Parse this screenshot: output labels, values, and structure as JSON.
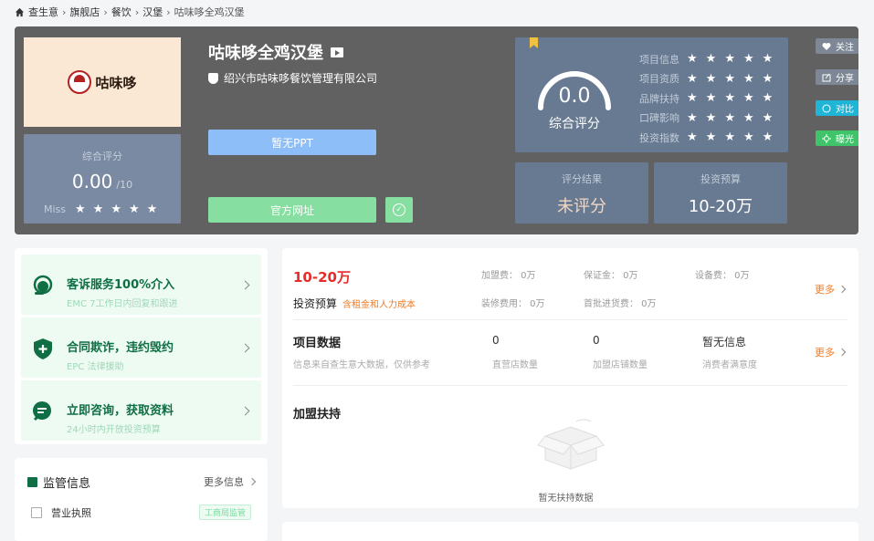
{
  "breadcrumb": {
    "items": [
      "查生意",
      "旗舰店",
      "餐饮",
      "汉堡"
    ],
    "current": "咕味哆全鸡汉堡"
  },
  "brand": {
    "name": "咕味哆全鸡汉堡",
    "company": "绍兴市咕味哆餐饮管理有限公司",
    "logo_text": "咕味哆"
  },
  "score_card": {
    "label": "综合评分",
    "value": "0.00",
    "max": "/10",
    "miss_label": "Miss",
    "stars": 5
  },
  "buttons": {
    "ppt": "暂无PPT",
    "website": "官方网址"
  },
  "rating": {
    "value": "0.0",
    "label": "综合评分",
    "rows": [
      {
        "label": "项目信息",
        "stars": 5
      },
      {
        "label": "项目资质",
        "stars": 5
      },
      {
        "label": "品牌扶持",
        "stars": 5
      },
      {
        "label": "口碑影响",
        "stars": 5
      },
      {
        "label": "投资指数",
        "stars": 5
      }
    ]
  },
  "stats": {
    "result_label": "评分结果",
    "result_value": "未评分",
    "budget_label": "投资预算",
    "budget_value": "10-20万"
  },
  "side_actions": {
    "follow": "关注",
    "share": "分享",
    "compare": "对比",
    "expose": "曝光"
  },
  "services": [
    {
      "title": "客诉服务100%介入",
      "sub": "EMC 7工作日内回复和跟进"
    },
    {
      "title": "合同欺诈，违约毁约",
      "sub": "EPC 法律援助"
    },
    {
      "title": "立即咨询，获取资料",
      "sub": "24小时内开放投资预算"
    }
  ],
  "regulation": {
    "title": "监管信息",
    "more": "更多信息",
    "item": "营业执照",
    "badge": "工商局监管"
  },
  "investment": {
    "amount": "10-20万",
    "label": "投资预算",
    "note": "含租金和人力成本",
    "fees": {
      "join": "加盟费： 0万",
      "deposit": "保证金： 0万",
      "equipment": "设备费： 0万",
      "decoration": "装修费用： 0万",
      "first_stock": "首批进货费： 0万"
    },
    "more": "更多"
  },
  "project_data": {
    "title": "项目数据",
    "desc": "信息来自查生意大数据，仅供参考",
    "direct_value": "0",
    "direct_label": "直营店数量",
    "franchise_value": "0",
    "franchise_label": "加盟店铺数量",
    "review_value": "暂无信息",
    "review_label": "消费者满意度",
    "more": "更多"
  },
  "support": {
    "title": "加盟扶持",
    "empty": "暂无扶持数据"
  },
  "colors": {
    "hero_bg": "#616161",
    "panel": "#687a92",
    "accent_green": "#0f6e43",
    "price_red": "#e52d2d",
    "orange": "#f07b26"
  }
}
